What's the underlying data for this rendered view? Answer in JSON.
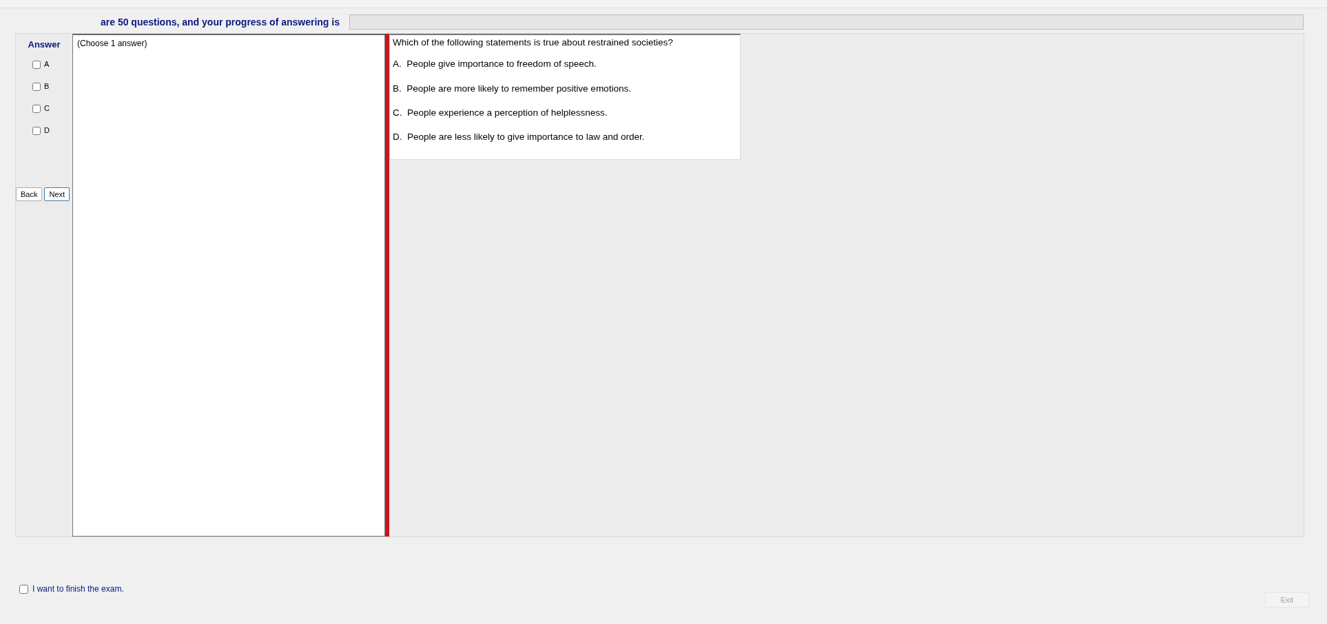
{
  "header": {
    "text": "are 50 questions, and your progress of answering is",
    "progress": {
      "level": 0
    }
  },
  "answer_panel": {
    "title": "Answer",
    "options": [
      {
        "label": "A",
        "checked": false
      },
      {
        "label": "B",
        "checked": false
      },
      {
        "label": "C",
        "checked": false
      },
      {
        "label": "D",
        "checked": false
      }
    ],
    "buttons": [
      {
        "label": "Back",
        "kind": "back"
      },
      {
        "label": "Next",
        "kind": "next"
      }
    ]
  },
  "instruction": "(Choose 1 answer)",
  "question": {
    "text": "Which of the following statements is true about restrained societies?",
    "choices": [
      "A.  People give importance to freedom of speech.",
      "B.  People are more likely to remember positive emotions.",
      "C.  People experience a perception of helplessness.",
      "D.  People are less likely to give importance to law and order."
    ]
  },
  "finish": {
    "label": "I want to finish the exam.",
    "checked": false
  },
  "exit_button": {
    "label": "Exit",
    "disabled": true
  }
}
